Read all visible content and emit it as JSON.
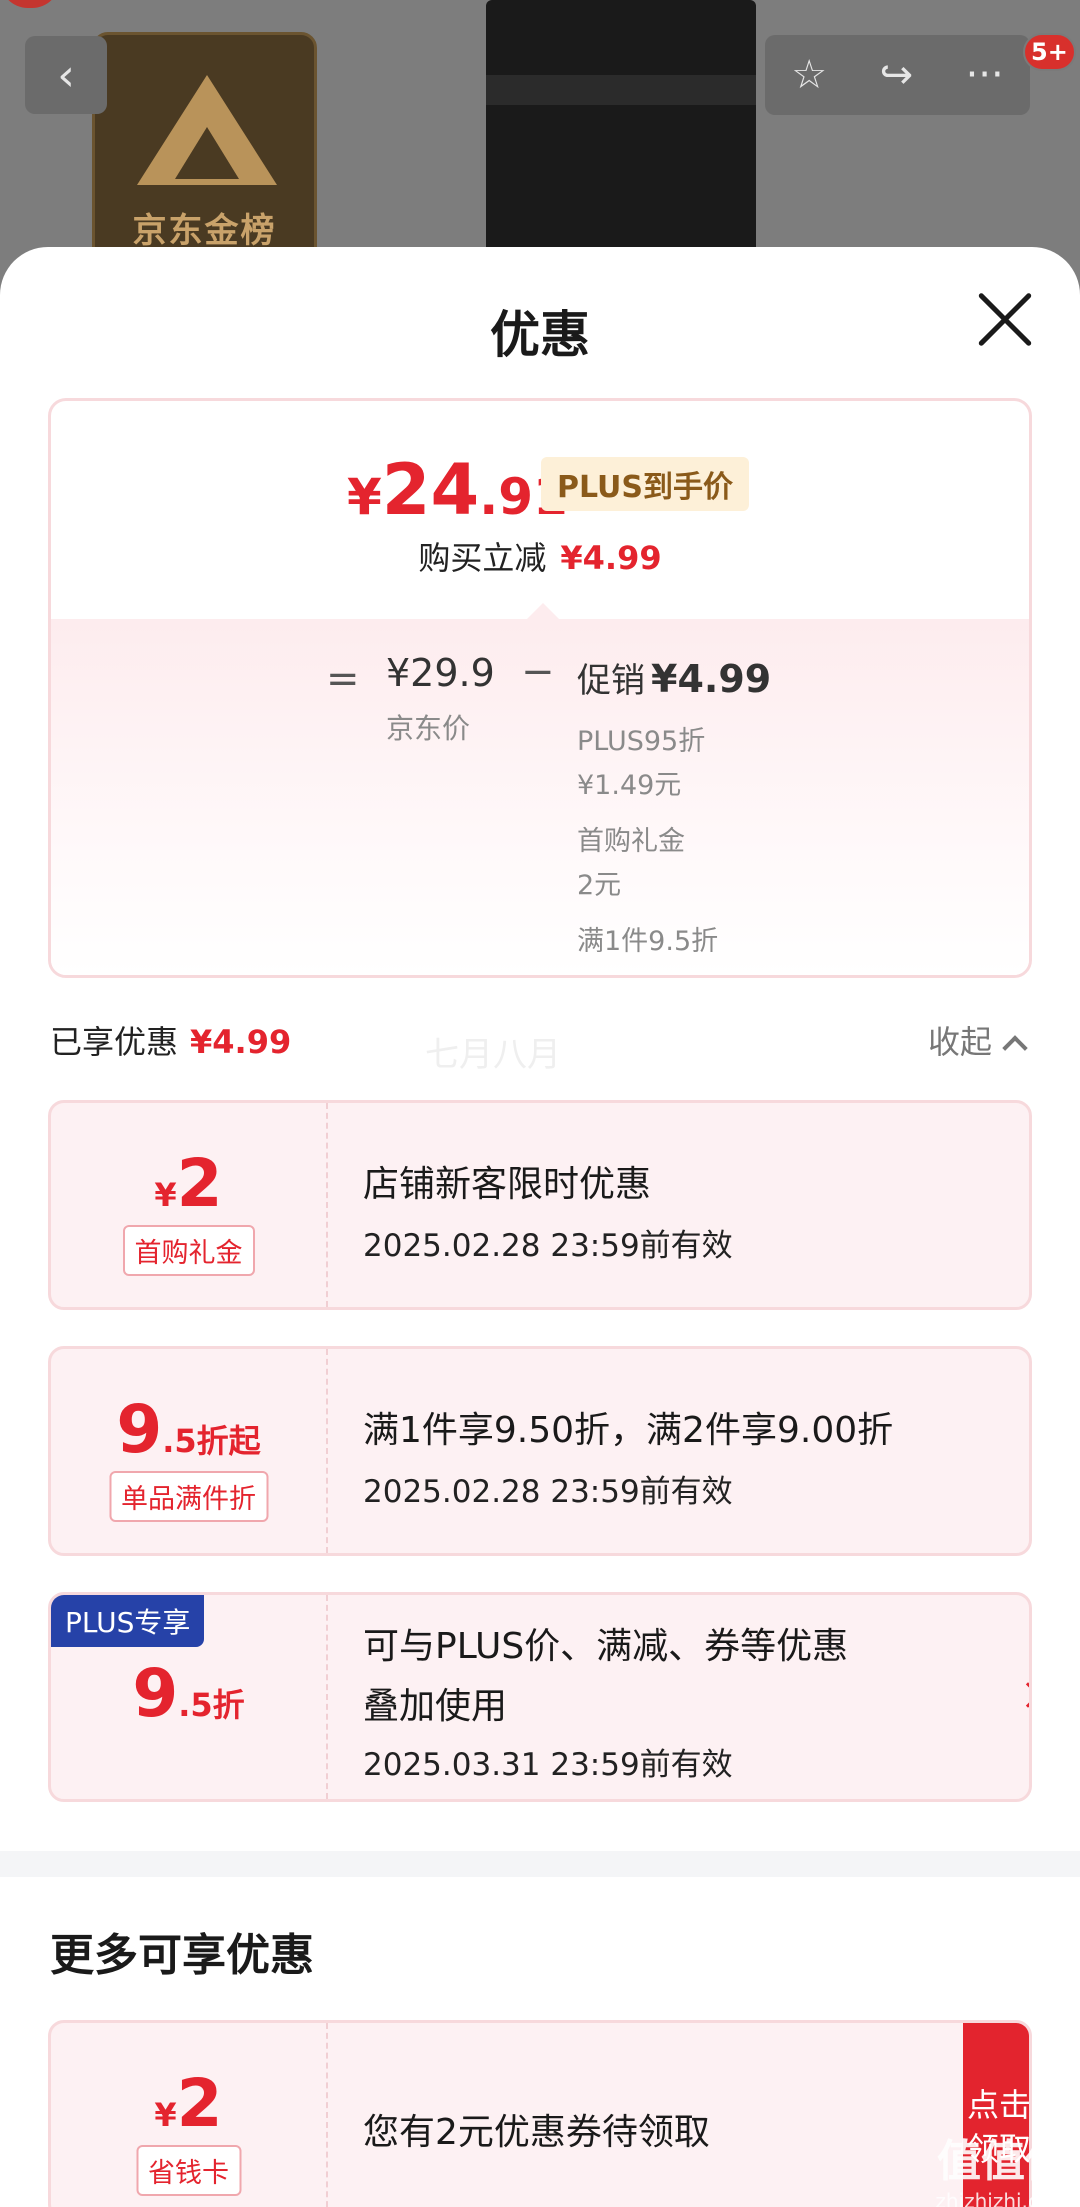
{
  "top_bar": {
    "badge_text": "京东金榜",
    "back_icon": "back-arrow-icon",
    "actions": [
      "star-icon",
      "share-icon",
      "more-icon"
    ],
    "notification_count": "5+"
  },
  "sheet": {
    "title": "优惠",
    "close_icon": "close-icon"
  },
  "price_card": {
    "currency": "¥",
    "price_int": "24",
    "price_dec": ".91",
    "price_type_tag": "PLUS到手价",
    "buy_minus_label": "购买立减",
    "buy_minus_value": "¥4.99",
    "equals": "=",
    "jd_price": "¥29.9",
    "jd_price_label": "京东价",
    "minus": "−",
    "promo_label": "促销",
    "promo_value": "¥4.99",
    "details": [
      "PLUS95折",
      "¥1.49元",
      "首购礼金",
      "2元",
      "满1件9.5折"
    ]
  },
  "applied": {
    "label": "已享优惠",
    "value": "¥4.99",
    "overlay_text": "七月八月",
    "collapse_label": "收起"
  },
  "coupons": [
    {
      "currency": "¥",
      "amount": "2",
      "suffix": "",
      "tag": "首购礼金",
      "title": "店铺新客限时优惠",
      "date": "2025.02.28 23:59前有效"
    },
    {
      "currency": "",
      "amount": "9",
      "suffix": ".5折起",
      "tag": "单品满件折",
      "title": "满1件享9.50折，满2件享9.00折",
      "date": "2025.02.28 23:59前有效"
    },
    {
      "corner": "PLUS专享",
      "currency": "",
      "amount": "9",
      "suffix": ".5折",
      "title_line1": "可与PLUS价、满减、券等优惠",
      "title_line2": "叠加使用",
      "date": "2025.03.31 23:59前有效"
    }
  ],
  "more": {
    "title": "更多可享优惠",
    "coupon": {
      "currency": "¥",
      "amount": "2",
      "tag": "省钱卡",
      "title": "您有2元优惠券待领取",
      "button": "点击领取"
    }
  },
  "watermark": {
    "big": "值值值",
    "small": "zhizhizhi.com"
  }
}
